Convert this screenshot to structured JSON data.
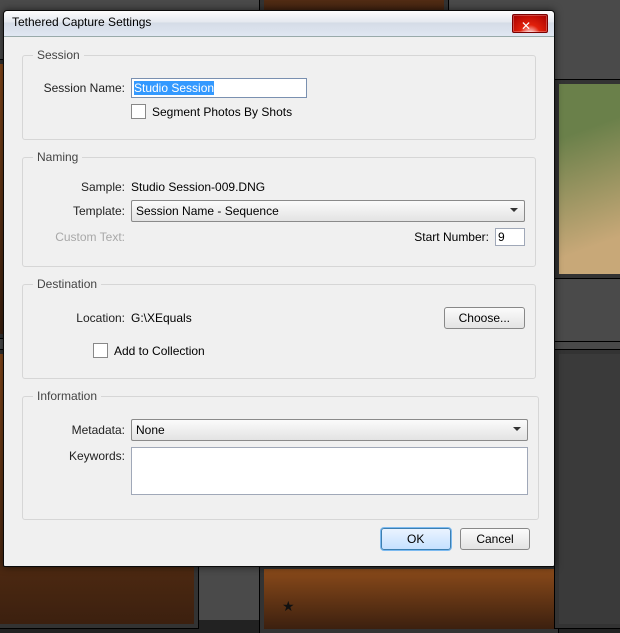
{
  "dialog": {
    "title": "Tethered Capture Settings",
    "close_glyph": "✕",
    "session": {
      "legend": "Session",
      "name_label": "Session Name:",
      "name_value": "Studio Session",
      "segment_label": "Segment Photos By Shots"
    },
    "naming": {
      "legend": "Naming",
      "sample_label": "Sample:",
      "sample_value": "Studio Session-009.DNG",
      "template_label": "Template:",
      "template_value": "Session Name - Sequence",
      "custom_label": "Custom Text:",
      "start_label": "Start Number:",
      "start_value": "9"
    },
    "destination": {
      "legend": "Destination",
      "location_label": "Location:",
      "location_value": "G:\\XEquals",
      "choose_label": "Choose...",
      "addcol_label": "Add to Collection"
    },
    "information": {
      "legend": "Information",
      "metadata_label": "Metadata:",
      "metadata_value": "None",
      "keywords_label": "Keywords:"
    },
    "ok": "OK",
    "cancel": "Cancel"
  }
}
